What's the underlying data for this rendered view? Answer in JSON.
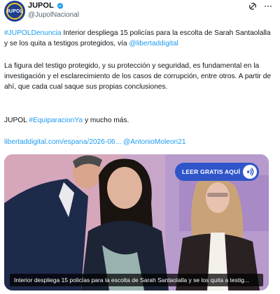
{
  "author": {
    "name": "JUPOL",
    "handle": "@JupolNacional",
    "avatar_text": "JUPOL",
    "verified_icon": "verified-badge-icon",
    "brand_color": "#1d3f8f"
  },
  "actions": {
    "grok_icon": "grok-icon",
    "more_icon": "more-options-icon"
  },
  "tweet": {
    "p1_hashtag": "#JUPOLDenuncia",
    "p1_text": " Interior despliega 15 policías para la escolta de Sarah Santaolalla y se los quita a testigos protegidos, vía ",
    "p1_mention": "@libertaddigital",
    "p2_text": "La figura del testigo protegido, y su protección y seguridad, es fundamental en la investigación y el esclarecimiento de los casos de corrupción, entre otros. A partir de ahí, que cada cual saque sus propias conclusiones.",
    "p3_prefix": "JUPOL ",
    "p3_hashtag": "#EquiparacionYa",
    "p3_suffix": " y mucho más.",
    "p4_link": "libertaddigital.com/espana/2026-06...",
    "p4_mention": " @AntonioMoleon21",
    "link_color": "#1d9bf0"
  },
  "media": {
    "cta_label": "LEER GRATIS AQUÍ",
    "cta_icon": "audio-play-icon",
    "cta_color": "#2f55c9",
    "caption": "Interior despliega 15 policías para la escolta de Sarah Santaolalla y se los quita a testig..."
  }
}
